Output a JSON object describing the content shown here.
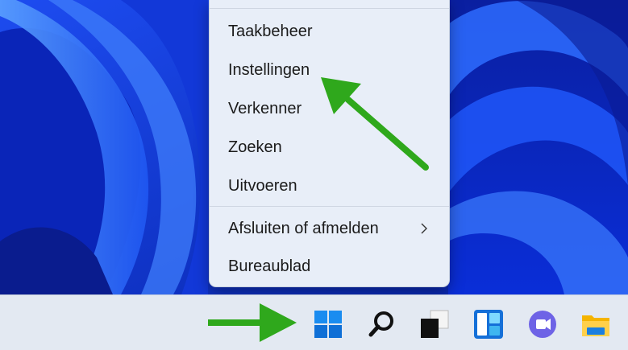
{
  "context_menu": {
    "items": [
      {
        "label": "Taakbeheer"
      },
      {
        "label": "Instellingen"
      },
      {
        "label": "Verkenner"
      },
      {
        "label": "Zoeken"
      },
      {
        "label": "Uitvoeren"
      },
      {
        "label": "Afsluiten of afmelden",
        "submenu_indicator": "chevron-right-icon"
      },
      {
        "label": "Bureaublad"
      }
    ]
  },
  "taskbar": {
    "icons": [
      "windows-start-icon",
      "search-icon",
      "task-view-icon",
      "widgets-icon",
      "teams-chat-icon",
      "file-explorer-icon"
    ]
  },
  "annotations": {
    "arrow_color": "#2fa81c"
  },
  "colors": {
    "wallpaper_base": "#0b2bd1",
    "menu_bg": "#e8eef8",
    "taskbar_bg": "#e3e9f2"
  }
}
